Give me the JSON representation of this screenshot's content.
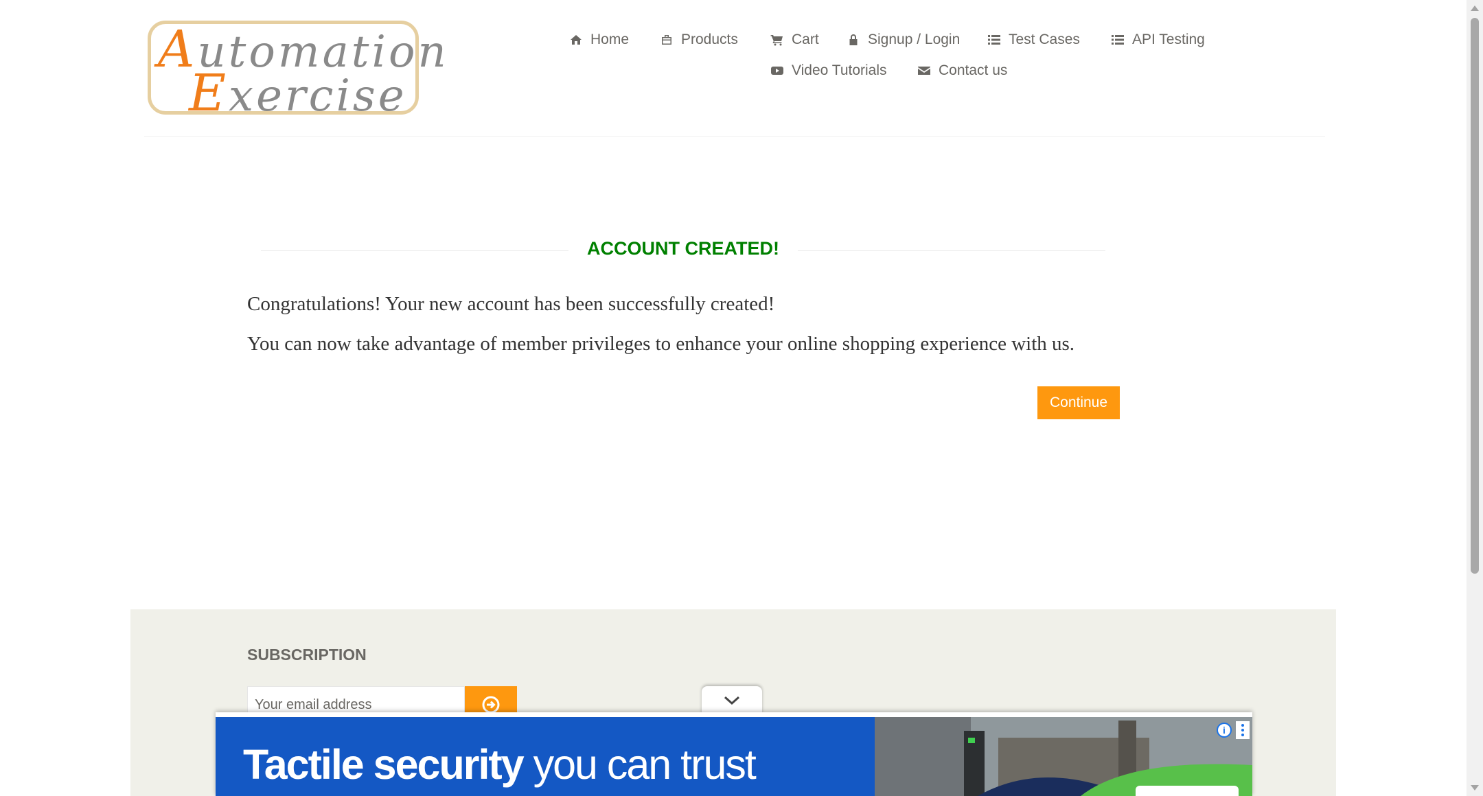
{
  "logo": {
    "line1_cap": "A",
    "line1_rest": "utomation",
    "line2_cap": "E",
    "line2_rest": "xercise"
  },
  "nav": {
    "items": [
      {
        "label": "Home",
        "icon": "home-icon"
      },
      {
        "label": "Products",
        "icon": "briefcase-icon"
      },
      {
        "label": "Cart",
        "icon": "cart-icon"
      },
      {
        "label": "Signup / Login",
        "icon": "lock-icon"
      },
      {
        "label": "Test Cases",
        "icon": "list-icon"
      },
      {
        "label": "API Testing",
        "icon": "list-icon"
      },
      {
        "label": "Video Tutorials",
        "icon": "youtube-play-icon"
      },
      {
        "label": "Contact us",
        "icon": "envelope-icon"
      }
    ]
  },
  "main": {
    "title": "ACCOUNT CREATED!",
    "message1": "Congratulations! Your new account has been successfully created!",
    "message2": "You can now take advantage of member privileges to enhance your online shopping experience with us.",
    "continue_label": "Continue"
  },
  "footer": {
    "subscription_title": "SUBSCRIPTION",
    "email_placeholder": "Your email address"
  },
  "ad": {
    "headline_bold": "Tactile security",
    "headline_rest": " you can trust",
    "info_symbol": "i"
  },
  "colors": {
    "accent": "#fe980f",
    "success": "#008000",
    "ad_blue": "#1458c4",
    "footer_bg": "#f0f0e9"
  }
}
